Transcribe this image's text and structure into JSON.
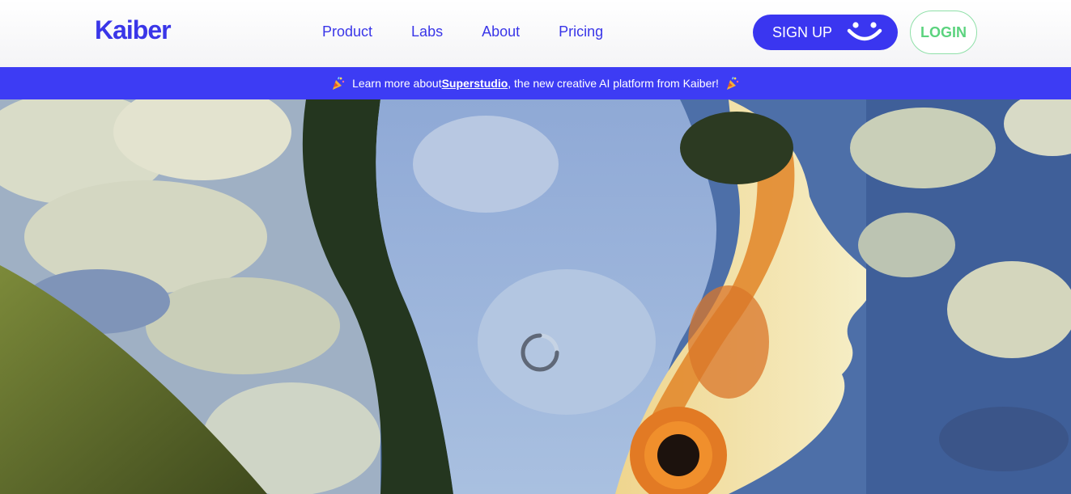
{
  "header": {
    "logo": "Kaiber",
    "nav": [
      "Product",
      "Labs",
      "About",
      "Pricing"
    ],
    "signup_label": "SIGN UP",
    "login_label": "LOGIN"
  },
  "banner": {
    "prefix": "Learn more about ",
    "link": "Superstudio",
    "suffix": ", the new creative AI platform from Kaiber!"
  },
  "colors": {
    "brand": "#3a36e8",
    "banner": "#3d3cf4",
    "login_green": "#5bd37e"
  },
  "icons": {
    "signup": "smiley-icon",
    "banner": "party-popper-icon",
    "hero": "loading-spinner-icon"
  }
}
